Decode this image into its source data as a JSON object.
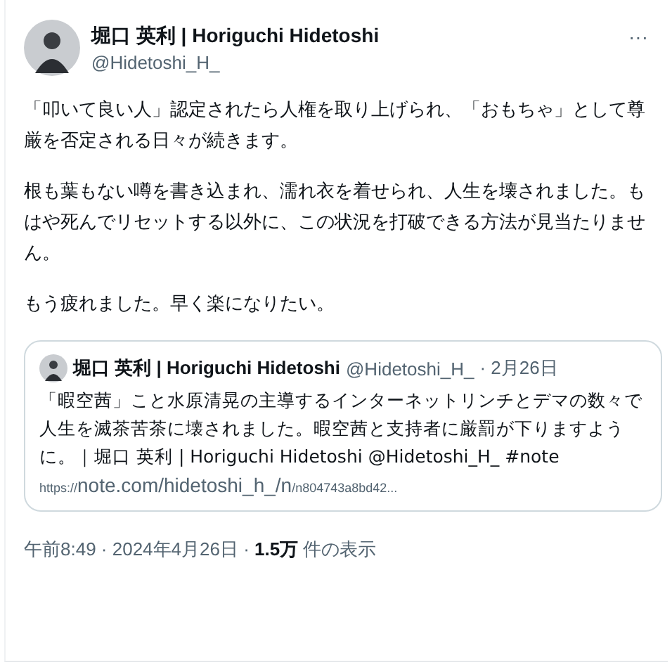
{
  "author": {
    "name": "堀口 英利 | Horiguchi Hidetoshi",
    "handle": "@Hidetoshi_H_"
  },
  "more": "···",
  "paragraphs": [
    "「叩いて良い人」認定されたら人権を取り上げられ、「おもちゃ」として尊厳を否定される日々が続きます。",
    "根も葉もない噂を書き込まれ、濡れ衣を着せられ、人生を壊されました。もはや死んでリセットする以外に、この状況を打破できる方法が見当たりません。",
    "もう疲れました。早く楽になりたい。"
  ],
  "quote": {
    "name": "堀口 英利 | Horiguchi Hidetoshi",
    "handle": "@Hidetoshi_H_",
    "date": "· 2月26日",
    "text": "「暇空茜」こと水原清晃の主導するインターネットリンチとデマの数々で人生を滅茶苦茶に壊されました。暇空茜と支持者に厳罰が下りますように。｜堀口 英利 | Horiguchi Hidetoshi @Hidetoshi_H_ #note",
    "url": {
      "scheme": "https://",
      "main": "note.com/hidetoshi_h_/n",
      "rest": "/n804743a8bd42..."
    }
  },
  "meta": "午前8:49 · 2024年4月26日 · **1.5万** 件の表示"
}
